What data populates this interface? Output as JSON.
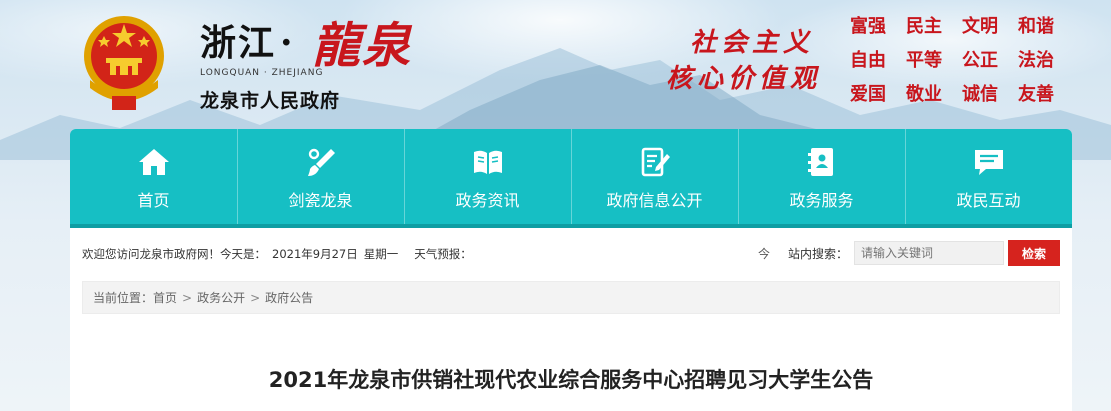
{
  "header": {
    "site_name": "浙江",
    "site_name_dot": "·",
    "site_calligraphy": "龍泉",
    "site_pinyin": "LONGQUAN · ZHEJIANG",
    "site_subtitle": "龙泉市人民政府",
    "slogan_line1": "社会主义",
    "slogan_line2": "核心价值观",
    "core_values": [
      "富强",
      "民主",
      "文明",
      "和谐",
      "自由",
      "平等",
      "公正",
      "法治",
      "爱国",
      "敬业",
      "诚信",
      "友善"
    ]
  },
  "nav": {
    "items": [
      {
        "label": "首页",
        "icon": "home-icon"
      },
      {
        "label": "剑瓷龙泉",
        "icon": "brush-icon"
      },
      {
        "label": "政务资讯",
        "icon": "book-icon"
      },
      {
        "label": "政府信息公开",
        "icon": "document-edit-icon"
      },
      {
        "label": "政务服务",
        "icon": "contact-card-icon"
      },
      {
        "label": "政民互动",
        "icon": "chat-icon"
      }
    ]
  },
  "info_bar": {
    "welcome": "欢迎您访问龙泉市政府网！今天是：",
    "date": "2021年9月27日",
    "weekday": "星期一",
    "weather_label": "天气预报："
  },
  "search": {
    "lang_glyph": "今",
    "label": "站内搜索：",
    "placeholder": "请输入关键词",
    "button": "检索"
  },
  "breadcrumb": {
    "prefix": "当前位置：",
    "items": [
      "首页",
      "政务公开",
      "政府公告"
    ],
    "separator": ">"
  },
  "article": {
    "title": "2021年龙泉市供销社现代农业综合服务中心招聘见习大学生公告"
  },
  "colors": {
    "nav_bg": "#16bfc4",
    "accent_red": "#c8161d",
    "search_button": "#d6231e"
  }
}
